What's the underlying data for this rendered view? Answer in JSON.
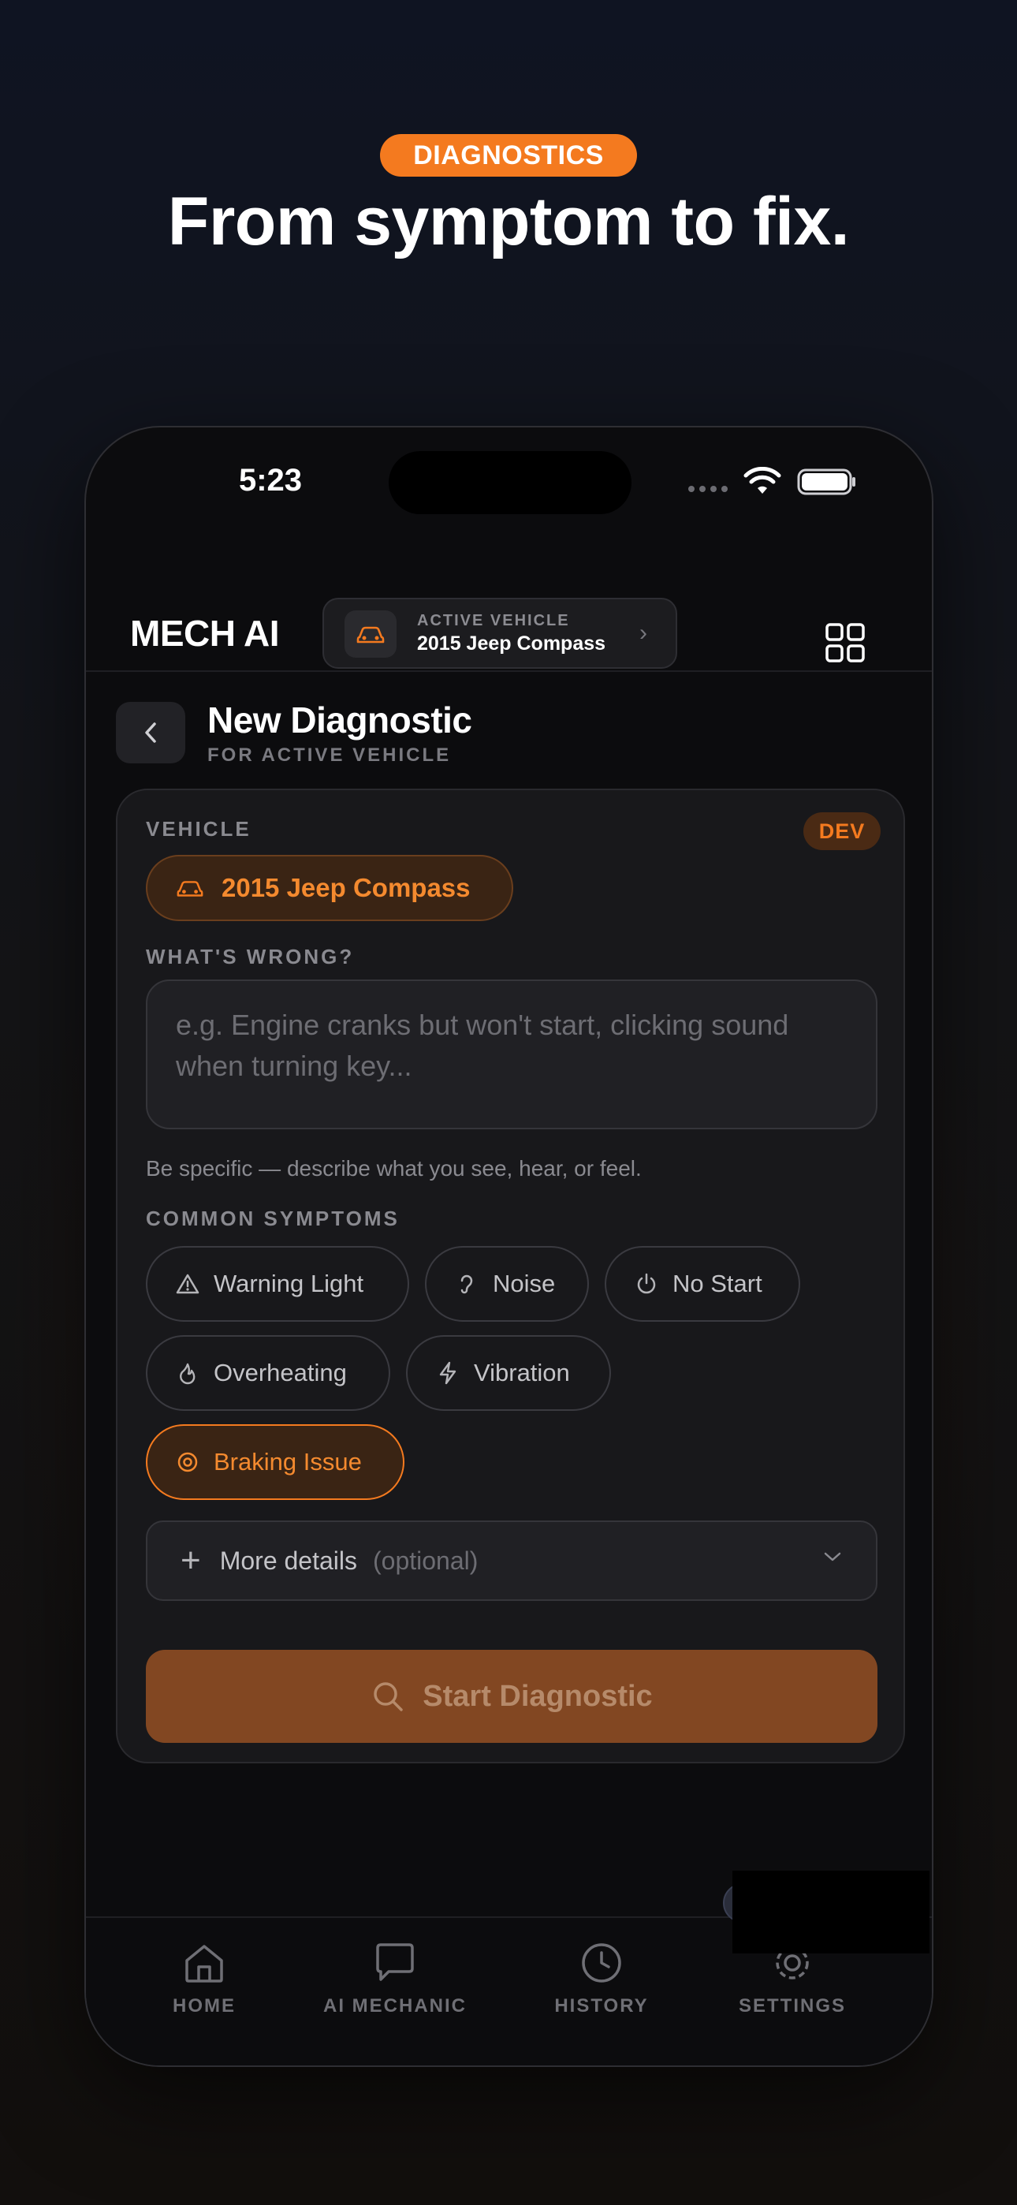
{
  "hero": {
    "badge": "DIAGNOSTICS",
    "title": "From symptom to fix."
  },
  "status_bar": {
    "time": "5:23"
  },
  "header": {
    "logo": "MECH AI",
    "active_vehicle_label": "ACTIVE VEHICLE",
    "active_vehicle_name": "2015 Jeep Compass",
    "icons": [
      "car-icon",
      "chevron-right-icon",
      "grid-icon"
    ]
  },
  "page": {
    "title": "New Diagnostic",
    "subtitle": "FOR ACTIVE VEHICLE"
  },
  "form": {
    "vehicle_label": "VEHICLE",
    "dev_badge": "DEV",
    "vehicle_value": "2015 Jeep Compass",
    "problem_label": "WHAT'S WRONG?",
    "problem_placeholder": "e.g. Engine cranks but won't start, clicking sound when turning key...",
    "problem_hint": "Be specific — describe what you see, hear, or feel.",
    "symptoms_label": "COMMON SYMPTOMS",
    "symptoms": [
      {
        "label": "Warning Light",
        "icon": "warning-triangle-icon",
        "selected": false
      },
      {
        "label": "Noise",
        "icon": "ear-icon",
        "selected": false
      },
      {
        "label": "No Start",
        "icon": "power-icon",
        "selected": false
      },
      {
        "label": "Overheating",
        "icon": "flame-icon",
        "selected": false
      },
      {
        "label": "Vibration",
        "icon": "lightning-icon",
        "selected": false
      },
      {
        "label": "Braking Issue",
        "icon": "brake-disc-icon",
        "selected": true
      }
    ],
    "more_details_label": "More details",
    "more_details_optional": "(optional)",
    "submit_label": "Start Diagnostic"
  },
  "tabbar": {
    "items": [
      {
        "label": "HOME",
        "icon": "home-icon"
      },
      {
        "label": "AI MECHANIC",
        "icon": "chat-bubble-icon"
      },
      {
        "label": "HISTORY",
        "icon": "clock-icon"
      },
      {
        "label": "SETTINGS",
        "icon": "gear-icon"
      }
    ]
  },
  "colors": {
    "accent": "#f47a1f",
    "background": "#0c0c0e",
    "card": "#18181b",
    "button_disabled": "#824722"
  }
}
